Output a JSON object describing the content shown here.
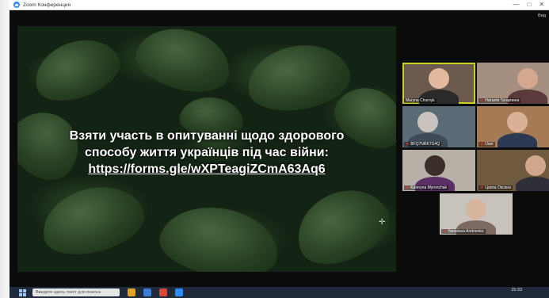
{
  "window": {
    "title": "Zoom Конференция",
    "controls": [
      "—",
      "□",
      "✕"
    ],
    "top_right_label": "Вид"
  },
  "slide": {
    "line1": "Взяти участь в опитуванні щодо здорового",
    "line2": "способу життя українців під час війни:",
    "url": "https://forms.gle/wXPTeagiZCmA63Aq6"
  },
  "participants": [
    {
      "name": "Maryna Chornyk",
      "muted": false,
      "active": true
    },
    {
      "name": "Наталія Гатарчина",
      "muted": true,
      "active": false
    },
    {
      "name": "BFQ7NRK7G4Q",
      "muted": true,
      "active": false
    },
    {
      "name": "User",
      "muted": true,
      "active": false
    },
    {
      "name": "Kateryna Myronchak",
      "muted": true,
      "active": false
    },
    {
      "name": "Цапка Оксана",
      "muted": true,
      "active": false
    },
    {
      "name": "Yaroslava Andrienko",
      "muted": true,
      "active": false
    }
  ],
  "taskbar": {
    "search_placeholder": "Введите здесь текст для поиска",
    "clock": "15:33"
  },
  "colors": {
    "active_speaker_border": "#c9d21f",
    "zoom_blue": "#2d8cff",
    "taskbar": "#1f2a3a"
  }
}
